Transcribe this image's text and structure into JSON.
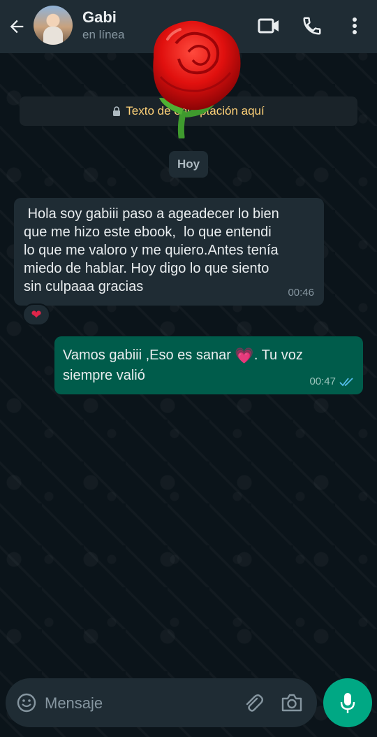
{
  "header": {
    "contact_name": "Gabi",
    "status": "en línea",
    "icons": [
      "back-arrow-icon",
      "video-call-icon",
      "phone-icon",
      "more-options-icon"
    ]
  },
  "chat": {
    "encryption_notice": "Texto de encriptación aquí",
    "date_separator": "Hoy",
    "messages": [
      {
        "direction": "incoming",
        "text": " Hola soy gabiii paso a ageadecer lo bien\nque me hizo este ebook,  lo que entendi\nlo que me valoro y me quiero.Antes tenía\nmiedo de hablar. Hoy digo lo que siento\nsin culpaaa gracias",
        "time": "00:46",
        "reaction": "❤"
      },
      {
        "direction": "outgoing",
        "text_before_emoji": "Vamos gabiii ,Eso es sanar ",
        "emoji": "💗",
        "text_after_emoji": ". Tu voz siempre valió",
        "time": "00:47",
        "status": "read"
      }
    ]
  },
  "composer": {
    "placeholder": "Mensaje",
    "icons": [
      "emoji-icon",
      "attach-icon",
      "camera-icon",
      "mic-icon"
    ]
  },
  "colors": {
    "background": "#0b141a",
    "header": "#1f2c34",
    "incoming_bubble": "#1f2c34",
    "outgoing_bubble": "#005c4b",
    "accent": "#00a884",
    "encryption_text": "#ffd279",
    "read_ticks": "#53bdeb"
  }
}
